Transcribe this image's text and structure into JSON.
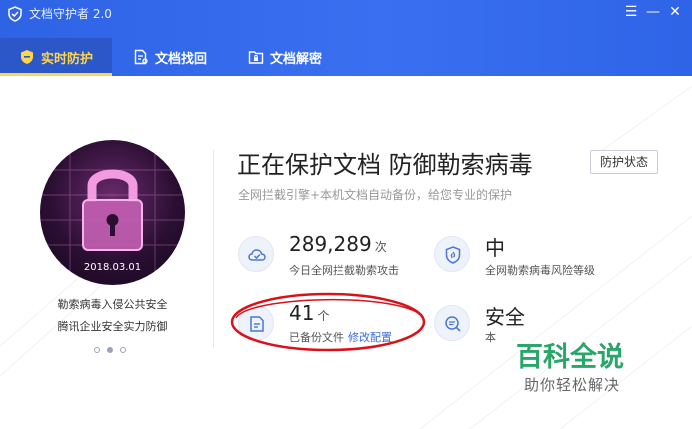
{
  "window": {
    "title": "文档守护者 2.0"
  },
  "tabs": [
    {
      "label": "实时防护"
    },
    {
      "label": "文档找回"
    },
    {
      "label": "文档解密"
    }
  ],
  "poster": {
    "date": "2018.03.01",
    "slogan_line1": "勒索病毒入侵公共安全",
    "slogan_line2": "腾讯企业安全实力防御",
    "carousel_count": 3,
    "carousel_active": 1
  },
  "main": {
    "headline": "正在保护文档 防御勒索病毒",
    "status_button": "防护状态",
    "subline": "全网拦截引擎+本机文档自动备份，给您专业的保护"
  },
  "stats": {
    "intercepts": {
      "value": "289,289",
      "unit": "次",
      "label": "今日全网拦截勒索攻击"
    },
    "risk": {
      "value": "中",
      "label": "全网勒索病毒风险等级"
    },
    "backups": {
      "value": "41",
      "unit": "个",
      "label": "已备份文件",
      "link": "修改配置"
    },
    "safety": {
      "value": "安全",
      "label": "本"
    }
  },
  "watermark": {
    "main": "百科全说",
    "sub": "助你轻松解决"
  },
  "colors": {
    "titlebar": "#2f63e6",
    "active_tab_text": "#ffd54a",
    "link": "#3b6cd9",
    "highlight": "#d8121a",
    "watermark": "#2aa66a"
  }
}
